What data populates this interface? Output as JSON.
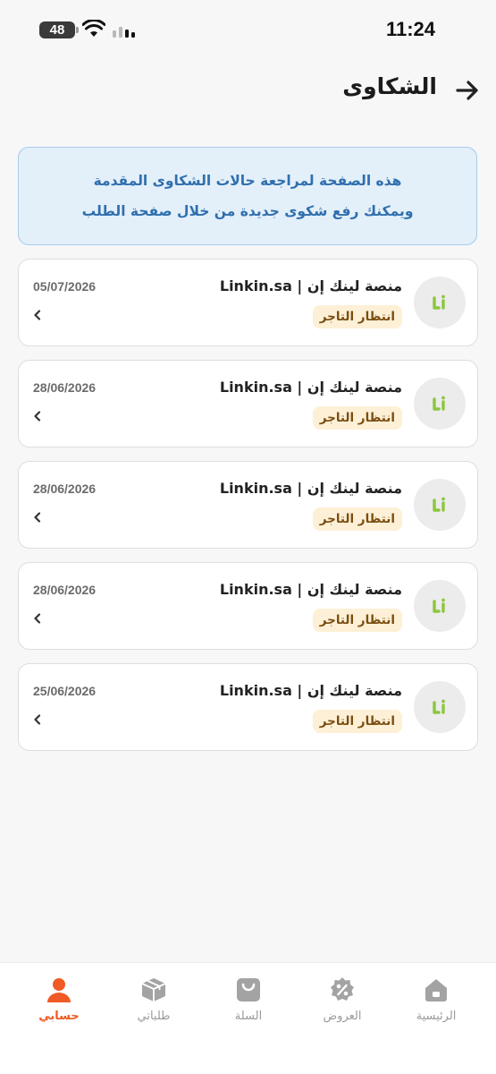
{
  "status_bar": {
    "battery": "48",
    "time": "11:24"
  },
  "header": {
    "title": "الشكاوى",
    "back_icon": "arrow-right-icon"
  },
  "info": {
    "line1": "هذه الصفحة لمراجعة حالات الشكاوى المقدمة",
    "line2": "ويمكنك رفع شكوى جديدة من خلال صفحة الطلب"
  },
  "complaints": [
    {
      "merchant": "منصة لينك إن | Linkin.sa",
      "status": "انتظار التاجر",
      "date": "05/07/2026"
    },
    {
      "merchant": "منصة لينك إن | Linkin.sa",
      "status": "انتظار التاجر",
      "date": "28/06/2026"
    },
    {
      "merchant": "منصة لينك إن | Linkin.sa",
      "status": "انتظار التاجر",
      "date": "28/06/2026"
    },
    {
      "merchant": "منصة لينك إن | Linkin.sa",
      "status": "انتظار التاجر",
      "date": "28/06/2026"
    },
    {
      "merchant": "منصة لينك إن | Linkin.sa",
      "status": "انتظار التاجر",
      "date": "25/06/2026"
    }
  ],
  "bottom_nav": [
    {
      "label": "الرئيسية",
      "icon": "home-icon",
      "active": false
    },
    {
      "label": "العروض",
      "icon": "discount-icon",
      "active": false
    },
    {
      "label": "السلة",
      "icon": "cart-bag-icon",
      "active": false
    },
    {
      "label": "طلباتي",
      "icon": "box-icon",
      "active": false
    },
    {
      "label": "حسابي",
      "icon": "user-icon",
      "active": true
    }
  ],
  "colors": {
    "accent": "#f05a24",
    "info_text": "#2f6fae",
    "info_bg": "#e3eff9",
    "badge_bg": "#fdf0d6",
    "badge_text": "#7a4d10",
    "logo_green": "#8cc63f"
  }
}
